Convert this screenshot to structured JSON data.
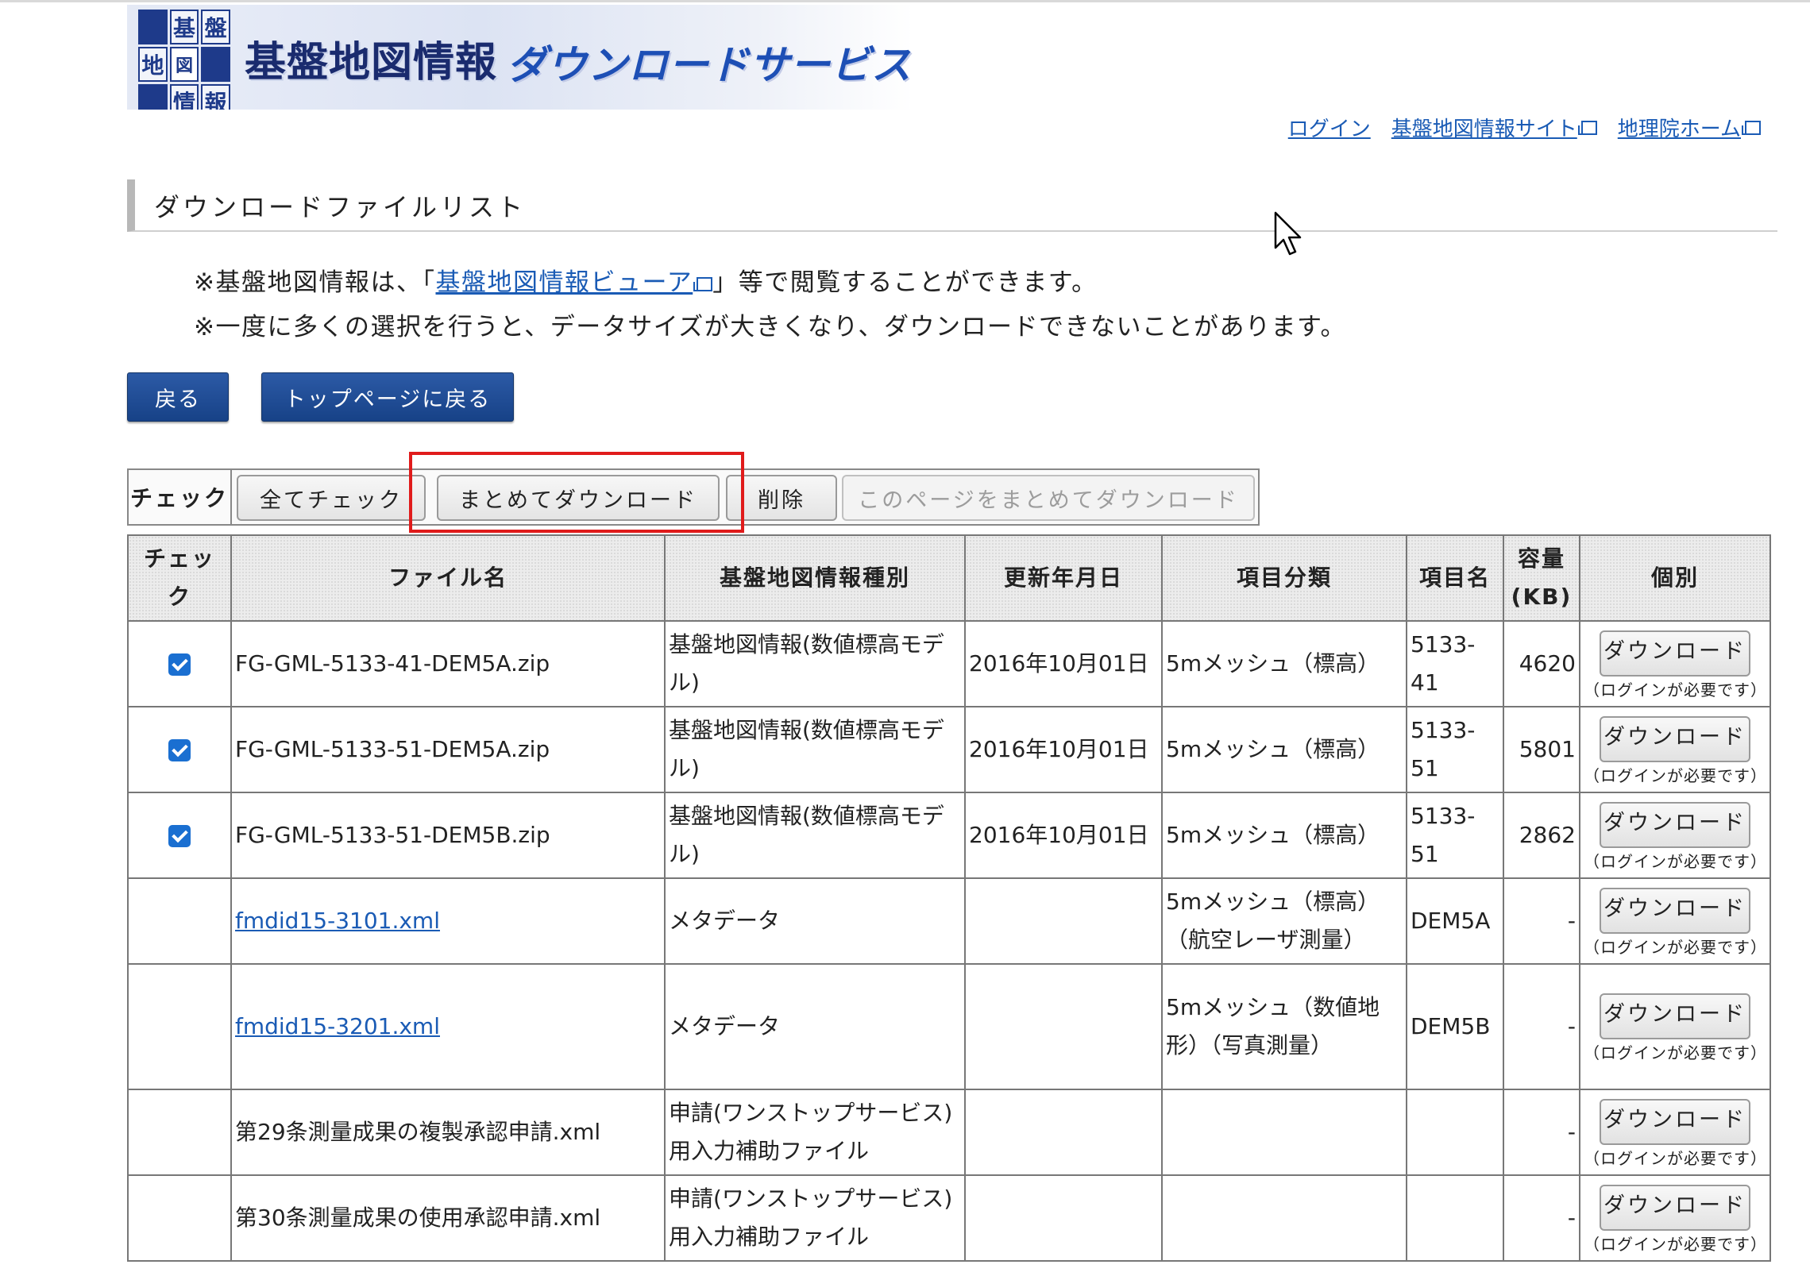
{
  "banner": {
    "logo_chars": [
      "基",
      "盤",
      "地",
      "図",
      "情",
      "報"
    ],
    "title": "基盤地図情報",
    "subtitle": "ダウンロードサービス"
  },
  "top_links": [
    {
      "label": "ログイン",
      "external": false
    },
    {
      "label": "基盤地図情報サイト",
      "external": true
    },
    {
      "label": "地理院ホーム",
      "external": true
    }
  ],
  "section_title": "ダウンロードファイルリスト",
  "notes": {
    "line1_prefix": "※基盤地図情報は、「",
    "line1_link": "基盤地図情報ビューア",
    "line1_suffix": "」等で閲覧することができます。",
    "line2": "※一度に多くの選択を行うと、データサイズが大きくなり、ダウンロードできないことがあります。"
  },
  "nav_buttons": {
    "back": "戻る",
    "top": "トップページに戻る"
  },
  "toolbar": {
    "label": "チェック",
    "check_all": "全てチェック",
    "bulk_download": "まとめてダウンロード",
    "delete": "削除",
    "page_download": "このページをまとめてダウンロード"
  },
  "table": {
    "headers": {
      "check": "チェック",
      "filename": "ファイル名",
      "type": "基盤地図情報種別",
      "updated": "更新年月日",
      "category": "項目分類",
      "item": "項目名",
      "size_l1": "容量",
      "size_l2": "(KB)",
      "individual": "個別"
    },
    "download_label": "ダウンロード",
    "login_note": "（ログインが必要です）",
    "rows": [
      {
        "checked": true,
        "filename": "FG-GML-5133-41-DEM5A.zip",
        "link": false,
        "type": "基盤地図情報(数値標高モデル)",
        "updated": "2016年10月01日",
        "category": "5mメッシュ（標高）",
        "item": "5133-41",
        "size": "4620"
      },
      {
        "checked": true,
        "filename": "FG-GML-5133-51-DEM5A.zip",
        "link": false,
        "type": "基盤地図情報(数値標高モデル)",
        "updated": "2016年10月01日",
        "category": "5mメッシュ（標高）",
        "item": "5133-51",
        "size": "5801"
      },
      {
        "checked": true,
        "filename": "FG-GML-5133-51-DEM5B.zip",
        "link": false,
        "type": "基盤地図情報(数値標高モデル)",
        "updated": "2016年10月01日",
        "category": "5mメッシュ（標高）",
        "item": "5133-51",
        "size": "2862"
      },
      {
        "checked": false,
        "filename": "fmdid15-3101.xml",
        "link": true,
        "type": "メタデータ",
        "updated": "",
        "category": "5mメッシュ（標高）（航空レーザ測量）",
        "item": "DEM5A",
        "size": "-"
      },
      {
        "checked": false,
        "filename": "fmdid15-3201.xml",
        "link": true,
        "type": "メタデータ",
        "updated": "",
        "category": "5mメッシュ（数値地形）（写真測量）",
        "item": "DEM5B",
        "size": "-"
      },
      {
        "checked": false,
        "filename": "第29条測量成果の複製承認申請.xml",
        "link": false,
        "type": "申請(ワンストップサービス)用入力補助ファイル",
        "updated": "",
        "category": "",
        "item": "",
        "size": "-"
      },
      {
        "checked": false,
        "filename": "第30条測量成果の使用承認申請.xml",
        "link": false,
        "type": "申請(ワンストップサービス)用入力補助ファイル",
        "updated": "",
        "category": "",
        "item": "",
        "size": "-"
      }
    ]
  }
}
